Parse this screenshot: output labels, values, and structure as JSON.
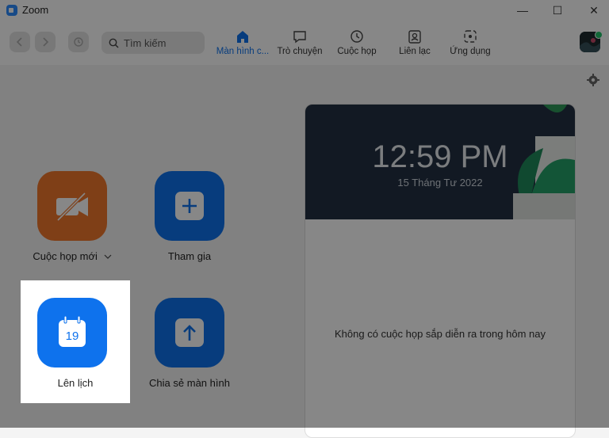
{
  "window": {
    "title": "Zoom",
    "minimize": "—",
    "maximize": "☐",
    "close": "✕"
  },
  "search": {
    "placeholder": "Tìm kiếm"
  },
  "tabs": [
    {
      "label": "Màn hình c...",
      "icon": "home-icon",
      "active": true
    },
    {
      "label": "Trò chuyện",
      "icon": "chat-icon",
      "active": false
    },
    {
      "label": "Cuộc họp",
      "icon": "clock-icon",
      "active": false
    },
    {
      "label": "Liên lạc",
      "icon": "contacts-icon",
      "active": false
    },
    {
      "label": "Ứng dụng",
      "icon": "apps-icon",
      "active": false
    }
  ],
  "actions": {
    "new_meeting": {
      "label": "Cuộc họp mới",
      "icon": "video-off-icon",
      "has_dropdown": true
    },
    "join": {
      "label": "Tham gia",
      "icon": "plus-icon"
    },
    "schedule": {
      "label": "Lên lịch",
      "icon": "calendar-icon",
      "calendar_day": "19"
    },
    "share_screen": {
      "label": "Chia sẻ màn hình",
      "icon": "upload-arrow-icon"
    }
  },
  "meeting_card": {
    "time": "12:59 PM",
    "date": "15 Tháng Tư 2022",
    "empty_message": "Không có cuộc họp sắp diễn ra trong hôm nay"
  },
  "colors": {
    "accent": "#0e72ed",
    "orange": "#f0772d",
    "banner": "#233042",
    "online": "#23c36a"
  }
}
